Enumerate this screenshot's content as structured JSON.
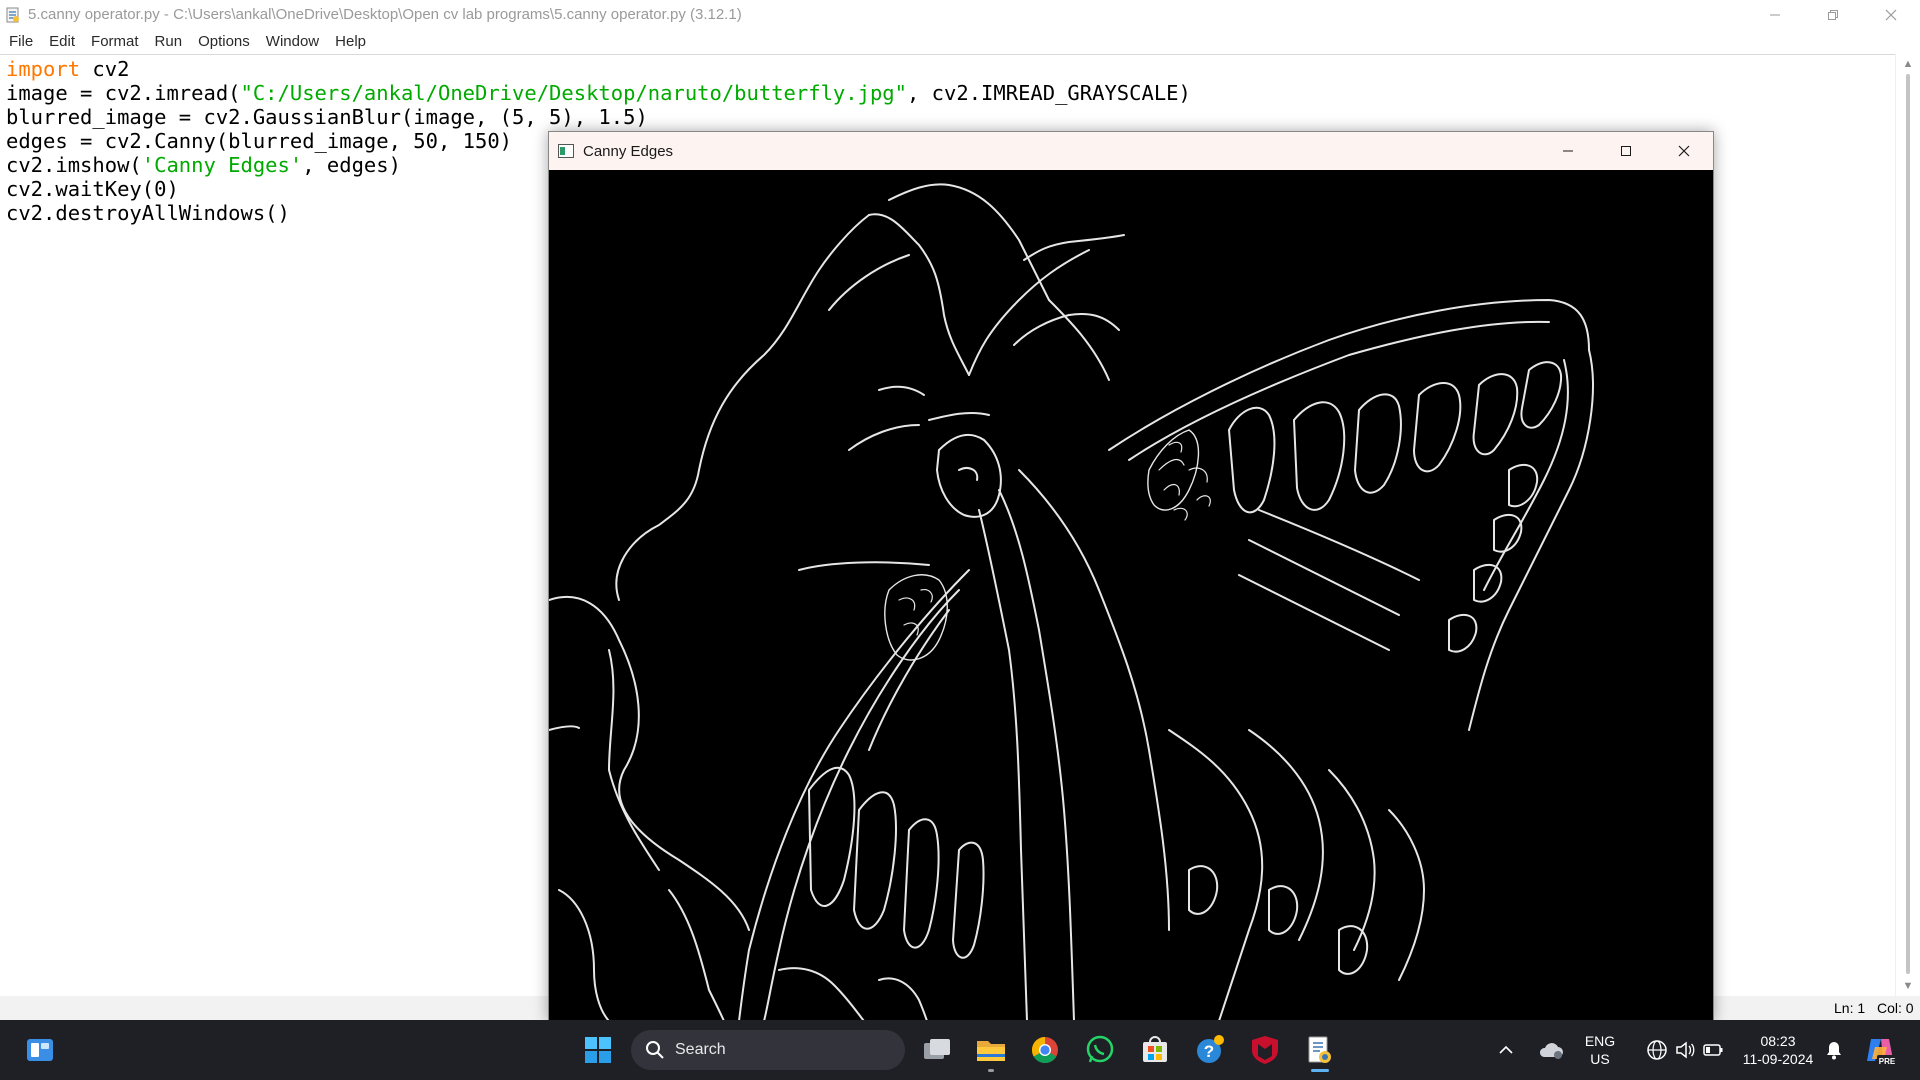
{
  "window": {
    "title": "5.canny operator.py - C:\\Users\\ankal\\OneDrive\\Desktop\\Open cv lab programs\\5.canny operator.py (3.12.1)"
  },
  "menu": [
    "File",
    "Edit",
    "Format",
    "Run",
    "Options",
    "Window",
    "Help"
  ],
  "code": {
    "line1_kw": "import",
    "line1_rest": " cv2",
    "line2_a": "image = cv2.imread(",
    "line2_str": "\"C:/Users/ankal/OneDrive/Desktop/naruto/butterfly.jpg\"",
    "line2_b": ", cv2.IMREAD_GRAYSCALE)",
    "line3": "blurred_image = cv2.GaussianBlur(image, (5, 5), 1.5)",
    "line4": "edges = cv2.Canny(blurred_image, 50, 150)",
    "line5_a": "cv2.imshow(",
    "line5_str": "'Canny Edges'",
    "line5_b": ", edges)",
    "line6": "cv2.waitKey(0)",
    "line7": "cv2.destroyAllWindows()"
  },
  "status": {
    "ln": "Ln: 1",
    "col": "Col: 0"
  },
  "cv_window": {
    "title": "Canny Edges"
  },
  "taskbar": {
    "search_label": "Search",
    "lang_line1": "ENG",
    "lang_line2": "US",
    "time": "08:23",
    "date": "11-09-2024",
    "pre_badge": "PRE"
  },
  "colors": {
    "keyword": "#ff7700",
    "string": "#00aa00",
    "taskbar_bg": "#1f1f26",
    "cv_titlebar_bg": "#fdf3f1"
  }
}
